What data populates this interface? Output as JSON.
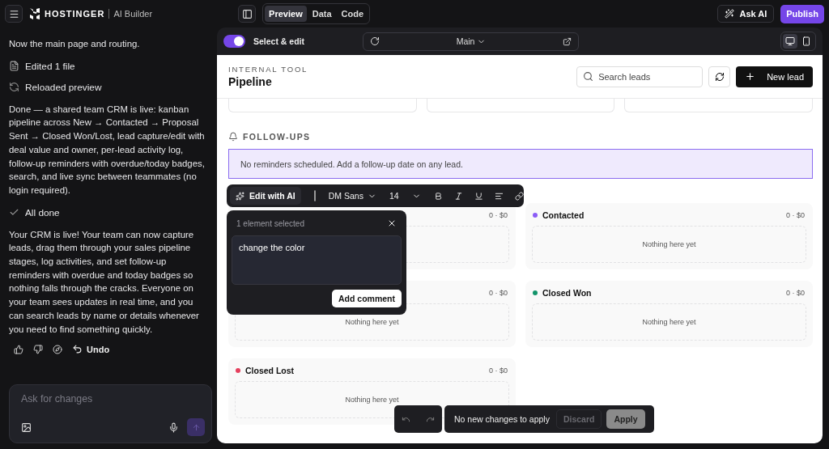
{
  "app": {
    "brand": "HOSTINGER",
    "product": "AI Builder"
  },
  "view_tabs": [
    {
      "label": "Preview",
      "selected": true
    },
    {
      "label": "Data",
      "selected": false
    },
    {
      "label": "Code",
      "selected": false
    }
  ],
  "top_actions": {
    "ask_ai": "Ask AI",
    "publish": "Publish"
  },
  "chat": [
    {
      "kind": "text",
      "text": "Now the main page and routing."
    },
    {
      "kind": "edited",
      "text": "Edited 1 file"
    },
    {
      "kind": "reloaded",
      "text": "Reloaded preview"
    },
    {
      "kind": "text",
      "text": "Done — a shared team CRM is live: kanban pipeline across New → Contacted → Proposal Sent → Closed Won/Lost, lead capture/edit with deal value and owner, per-lead activity log, follow-up reminders with overdue/today badges, search, and live sync between teammates (no login required)."
    },
    {
      "kind": "done",
      "text": "All done"
    },
    {
      "kind": "text",
      "text": "Your CRM is live! Your team can now capture leads, drag them through your sales pipeline stages, log activities, and set follow-up reminders with overdue and today badges so nothing falls through the cracks. Everyone on your team sees updates in real time, and you can search leads by name or details whenever you need to find something quickly."
    }
  ],
  "feedback": {
    "undo": "Undo"
  },
  "composer": {
    "placeholder": "Ask for changes"
  },
  "preview_toolbar": {
    "select_edit": {
      "label": "Select & edit",
      "on": true
    },
    "page": "Main",
    "devices": [
      {
        "kind": "desktop",
        "selected": true
      },
      {
        "kind": "mobile",
        "selected": false
      }
    ]
  },
  "page": {
    "eyebrow": "INTERNAL TOOL",
    "title": "Pipeline",
    "search": {
      "placeholder": "Search leads"
    },
    "new_lead": "New lead",
    "followups": {
      "heading": "FOLLOW-UPS",
      "notice": "No reminders scheduled. Add a follow-up date on any lead."
    },
    "stages": [
      {
        "summary": "0 · $0"
      },
      {
        "title": "Contacted",
        "color": "#8b5cf6",
        "summary": "0 · $0",
        "empty_text": "Nothing here yet"
      },
      {
        "summary": "0 · $0",
        "empty_text": "Nothing here yet"
      },
      {
        "title": "Closed Won",
        "color": "#12946a",
        "summary": "0 · $0",
        "empty_text": "Nothing here yet"
      },
      {
        "title": "Closed Lost",
        "color": "#e5405e",
        "summary": "0 · $0",
        "empty_text": "Nothing here yet"
      }
    ]
  },
  "format_bar": {
    "edit_ai": "Edit with AI",
    "font": "DM Sans",
    "size": "14"
  },
  "comment": {
    "header": "1 element selected",
    "value": "change the color",
    "button": "Add comment"
  },
  "changes_bar": {
    "message": "No new changes to apply",
    "discard": {
      "label": "Discard",
      "disabled": true
    },
    "apply": {
      "label": "Apply",
      "disabled": true
    }
  }
}
